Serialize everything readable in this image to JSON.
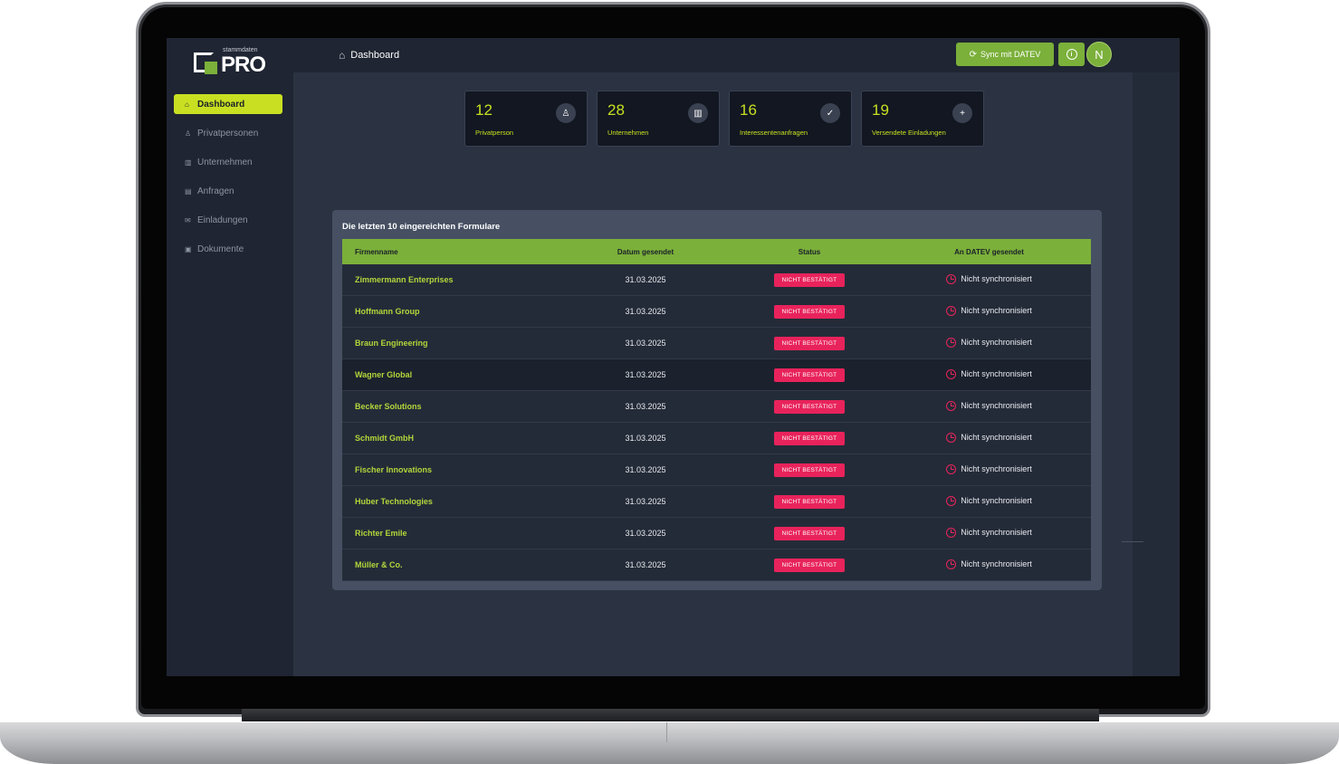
{
  "logo": {
    "small": "stammdaten",
    "big": "PRO"
  },
  "sidebar": {
    "items": [
      {
        "label": "Dashboard",
        "icon": "home-icon",
        "active": true
      },
      {
        "label": "Privatpersonen",
        "icon": "person-icon"
      },
      {
        "label": "Unternehmen",
        "icon": "building-icon"
      },
      {
        "label": "Anfragen",
        "icon": "inbox-icon"
      },
      {
        "label": "Einladungen",
        "icon": "mail-icon"
      },
      {
        "label": "Dokumente",
        "icon": "document-icon"
      }
    ]
  },
  "header": {
    "breadcrumb": "Dashboard",
    "sync_label": "Sync mit DATEV",
    "avatar_initial": "N"
  },
  "stats": [
    {
      "value": "12",
      "label": "Privatperson",
      "icon": "person-icon"
    },
    {
      "value": "28",
      "label": "Unternehmen",
      "icon": "building-icon"
    },
    {
      "value": "16",
      "label": "Interessentenanfragen",
      "icon": "document-check-icon"
    },
    {
      "value": "19",
      "label": "Versendete Einladungen",
      "icon": "document-plus-icon"
    }
  ],
  "panel": {
    "title": "Die letzten 10 eingereichten Formulare",
    "columns": [
      "Firmenname",
      "Datum gesendet",
      "Status",
      "An DATEV gesendet"
    ],
    "rows": [
      {
        "name": "Zimmermann Enterprises",
        "date": "31.03.2025",
        "status": "NICHT BESTÄTIGT",
        "sync": "Nicht synchronisiert"
      },
      {
        "name": "Hoffmann Group",
        "date": "31.03.2025",
        "status": "NICHT BESTÄTIGT",
        "sync": "Nicht synchronisiert"
      },
      {
        "name": "Braun Engineering",
        "date": "31.03.2025",
        "status": "NICHT BESTÄTIGT",
        "sync": "Nicht synchronisiert"
      },
      {
        "name": "Wagner Global",
        "date": "31.03.2025",
        "status": "NICHT BESTÄTIGT",
        "sync": "Nicht synchronisiert"
      },
      {
        "name": "Becker Solutions",
        "date": "31.03.2025",
        "status": "NICHT BESTÄTIGT",
        "sync": "Nicht synchronisiert"
      },
      {
        "name": "Schmidt GmbH",
        "date": "31.03.2025",
        "status": "NICHT BESTÄTIGT",
        "sync": "Nicht synchronisiert"
      },
      {
        "name": "Fischer Innovations",
        "date": "31.03.2025",
        "status": "NICHT BESTÄTIGT",
        "sync": "Nicht synchronisiert"
      },
      {
        "name": "Huber Technologies",
        "date": "31.03.2025",
        "status": "NICHT BESTÄTIGT",
        "sync": "Nicht synchronisiert"
      },
      {
        "name": "Richter Emile",
        "date": "31.03.2025",
        "status": "NICHT BESTÄTIGT",
        "sync": "Nicht synchronisiert"
      },
      {
        "name": "Müller & Co.",
        "date": "31.03.2025",
        "status": "NICHT BESTÄTIGT",
        "sync": "Nicht synchronisiert"
      }
    ]
  },
  "colors": {
    "accent": "#c8e021",
    "green": "#7bb03a",
    "danger": "#e8235b",
    "bg": "#2b3342",
    "sidebar": "#1f2532"
  }
}
